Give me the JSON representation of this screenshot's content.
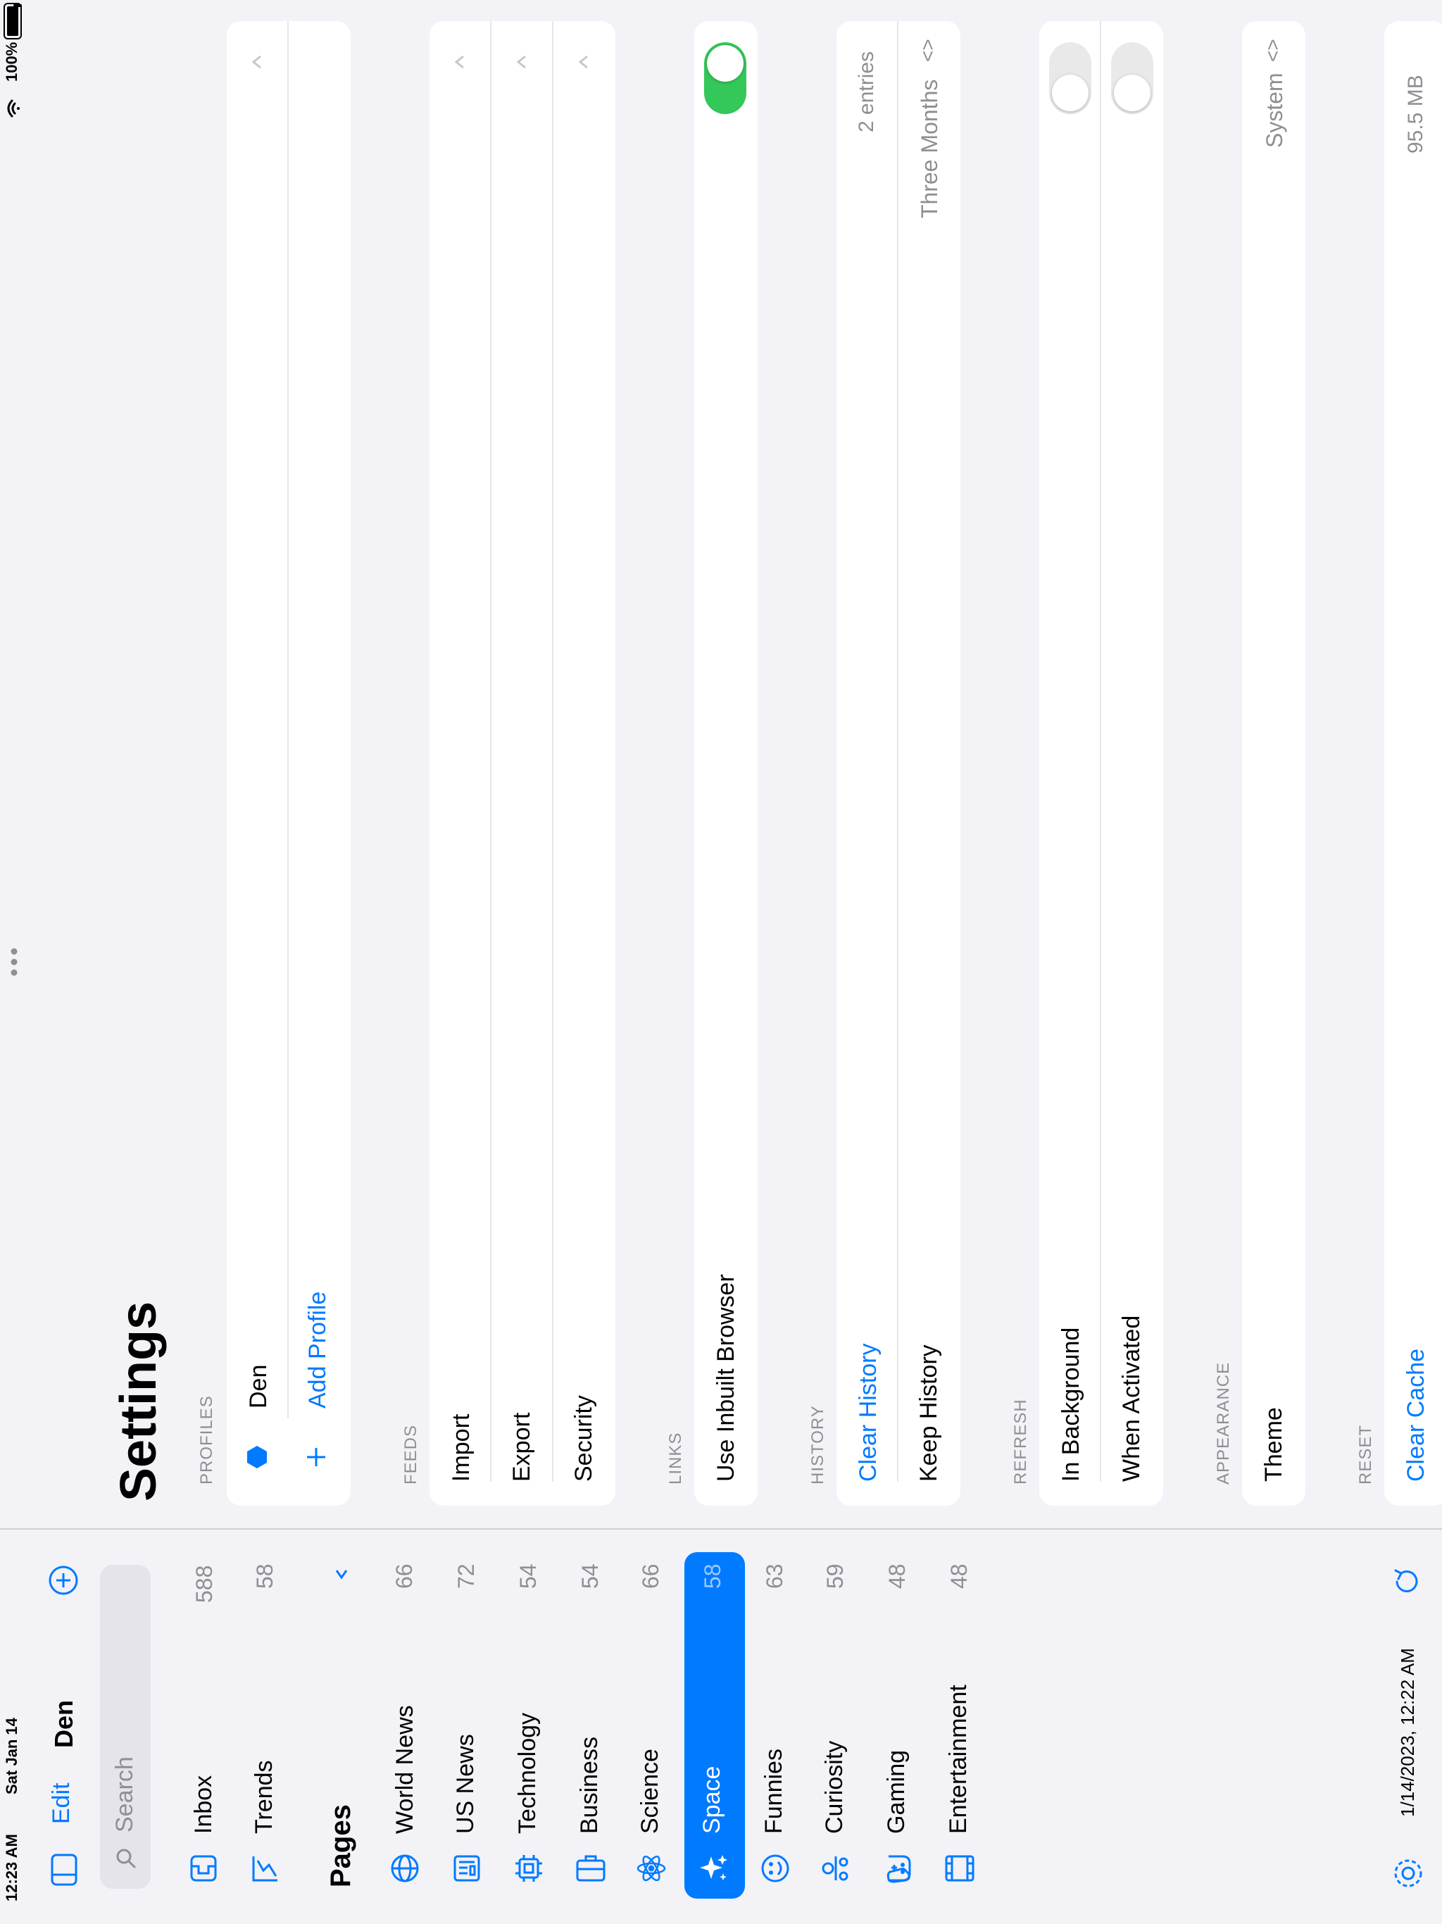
{
  "status_bar": {
    "time": "12:23 AM",
    "date": "Sat Jan 14",
    "battery": "100%"
  },
  "sidebar": {
    "edit_label": "Edit",
    "profile_name": "Den",
    "search_placeholder": "Search",
    "top_items": [
      {
        "label": "Inbox",
        "count": "588",
        "icon": "inbox-icon"
      },
      {
        "label": "Trends",
        "count": "58",
        "icon": "trends-icon"
      }
    ],
    "pages_heading": "Pages",
    "pages": [
      {
        "label": "World News",
        "count": "66",
        "icon": "globe-icon"
      },
      {
        "label": "US News",
        "count": "72",
        "icon": "newspaper-icon"
      },
      {
        "label": "Technology",
        "count": "54",
        "icon": "chip-icon"
      },
      {
        "label": "Business",
        "count": "54",
        "icon": "briefcase-icon"
      },
      {
        "label": "Science",
        "count": "66",
        "icon": "atom-icon"
      },
      {
        "label": "Space",
        "count": "58",
        "icon": "sparkles-icon",
        "selected": true
      },
      {
        "label": "Funnies",
        "count": "63",
        "icon": "smiley-icon"
      },
      {
        "label": "Curiosity",
        "count": "59",
        "icon": "curiosity-icon"
      },
      {
        "label": "Gaming",
        "count": "48",
        "icon": "gamecontroller-icon"
      },
      {
        "label": "Entertainment",
        "count": "48",
        "icon": "film-icon"
      }
    ],
    "last_sync": "1/14/2023, 12:22 AM",
    "accent_color": "#007aff"
  },
  "settings": {
    "title": "Settings",
    "profiles": {
      "label": "PROFILES",
      "profile_name": "Den",
      "add_profile": "Add Profile"
    },
    "feeds": {
      "label": "FEEDS",
      "items": [
        "Import",
        "Export",
        "Security"
      ]
    },
    "links": {
      "label": "LINKS",
      "use_inbuilt_browser": "Use Inbuilt Browser",
      "use_inbuilt_browser_on": true
    },
    "history": {
      "label": "HISTORY",
      "clear_history": "Clear History",
      "entries": "2 entries",
      "keep_history": "Keep History",
      "keep_history_value": "Three Months"
    },
    "refresh": {
      "label": "REFRESH",
      "in_background": "In Background",
      "in_background_on": false,
      "when_activated": "When Activated",
      "when_activated_on": false
    },
    "appearance": {
      "label": "APPEARANCE",
      "theme": "Theme",
      "theme_value": "System"
    },
    "reset": {
      "label": "RESET",
      "clear_cache": "Clear Cache",
      "cache_size": "95.5 MB"
    },
    "toggle_on_color": "#34c759"
  }
}
